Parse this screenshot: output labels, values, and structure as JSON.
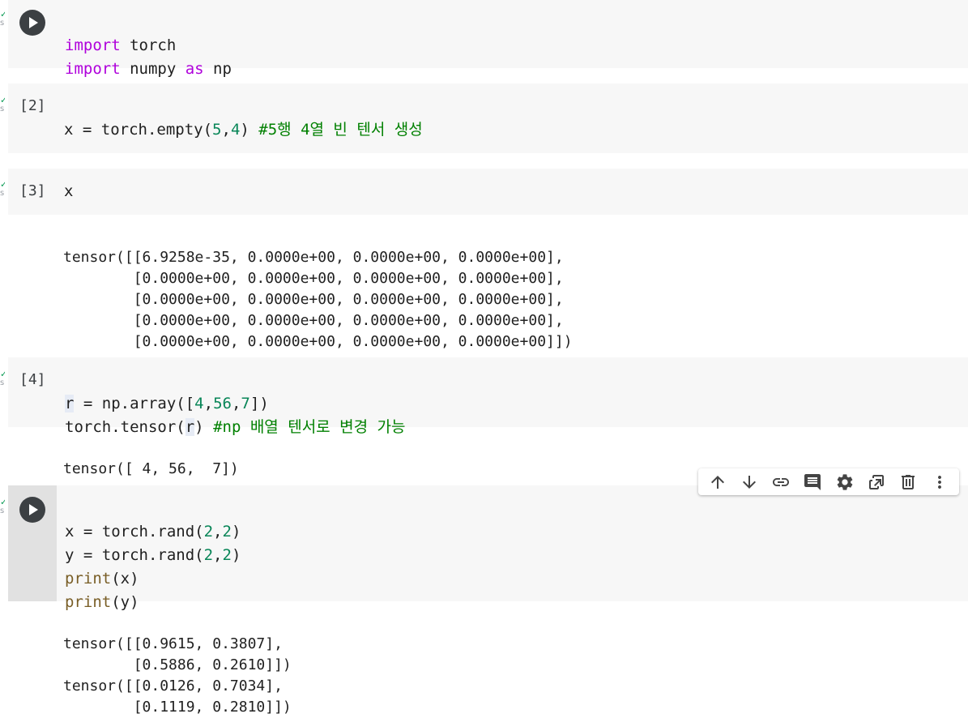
{
  "cells": [
    {
      "id": "cell-1",
      "count": "",
      "code": [
        "import torch",
        "import numpy as np"
      ]
    },
    {
      "id": "cell-2",
      "count": "[2]",
      "code": [
        "x = torch.empty(5,4) #5행 4열 빈 텐서 생성"
      ]
    },
    {
      "id": "cell-3",
      "count": "[3]",
      "code": [
        "x"
      ],
      "output": [
        "tensor([[6.9258e-35, 0.0000e+00, 0.0000e+00, 0.0000e+00],",
        "        [0.0000e+00, 0.0000e+00, 0.0000e+00, 0.0000e+00],",
        "        [0.0000e+00, 0.0000e+00, 0.0000e+00, 0.0000e+00],",
        "        [0.0000e+00, 0.0000e+00, 0.0000e+00, 0.0000e+00],",
        "        [0.0000e+00, 0.0000e+00, 0.0000e+00, 0.0000e+00]])"
      ]
    },
    {
      "id": "cell-4",
      "count": "[4]",
      "code": [
        "r = np.array([4,56,7])",
        "torch.tensor(r) #np 배열 텐서로 변경 가능"
      ],
      "output": [
        "tensor([ 4, 56,  7])"
      ]
    },
    {
      "id": "cell-5",
      "count": "",
      "code": [
        "x = torch.rand(2,2)",
        "y = torch.rand(2,2)",
        "print(x)",
        "print(y)"
      ],
      "output": [
        "tensor([[0.9615, 0.3807],",
        "        [0.5886, 0.2610]])",
        "tensor([[0.0126, 0.7034],",
        "        [0.1119, 0.2810]])"
      ]
    }
  ],
  "toolbar": {
    "icons": [
      "arrow-up-icon",
      "arrow-down-icon",
      "link-icon",
      "comment-icon",
      "gear-icon",
      "mirror-cell-icon",
      "delete-icon",
      "more-vert-icon"
    ]
  },
  "colors": {
    "keyword": "#af00db",
    "number": "#098658",
    "function": "#795e26",
    "comment": "#008000",
    "cell_bg": "#f7f7f7",
    "active_band": "#e1e1e1"
  }
}
